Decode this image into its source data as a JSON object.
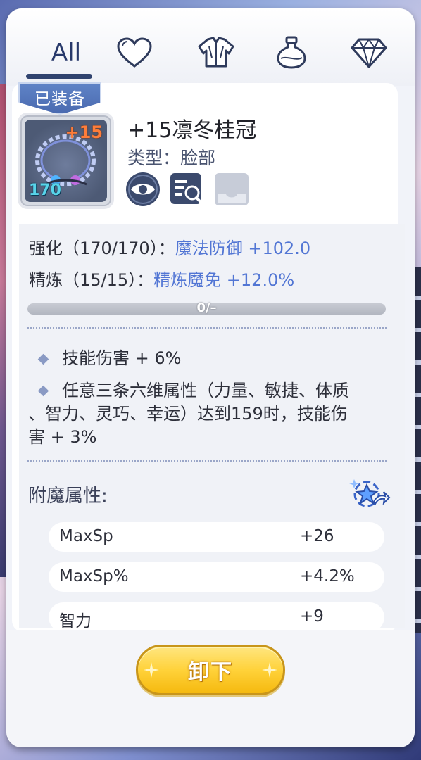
{
  "tabs": {
    "all_label": "All",
    "icons": [
      "heart-icon",
      "armor-icon",
      "potion-icon",
      "diamond-icon"
    ]
  },
  "item": {
    "equipped_badge": "已装备",
    "plus_level": "+15",
    "level": "170",
    "name": "+15凛冬桂冠",
    "type": "类型：脸部",
    "actions": [
      "eye-icon",
      "inspect-icon",
      "tray-icon"
    ]
  },
  "stats": {
    "refine_label": "强化（170/170）：",
    "refine_value": "魔法防御 +102.0",
    "smelt_label": "精炼（15/15）：",
    "smelt_value": "精炼魔免 +12.0%",
    "progress_text": "0/–",
    "progress_fraction": 0
  },
  "skills": [
    "技能伤害 + 6%",
    "任意三条六维属性（力量、敏捷、体质",
    "、智力、灵巧、幸运）达到159时，技能伤",
    "害 + 3%"
  ],
  "enchant": {
    "title": "附魔属性:",
    "rows": [
      {
        "name": "MaxSp",
        "value": "+26"
      },
      {
        "name": "MaxSp%",
        "value": "+4.2%"
      },
      {
        "name": "智力",
        "value": "+9"
      }
    ]
  },
  "footer": {
    "unequip_label": "卸下"
  },
  "colors": {
    "accent_blue": "#5276d4",
    "badge_blue": "#5f83c6",
    "button_yellow": "#ffd23a"
  }
}
